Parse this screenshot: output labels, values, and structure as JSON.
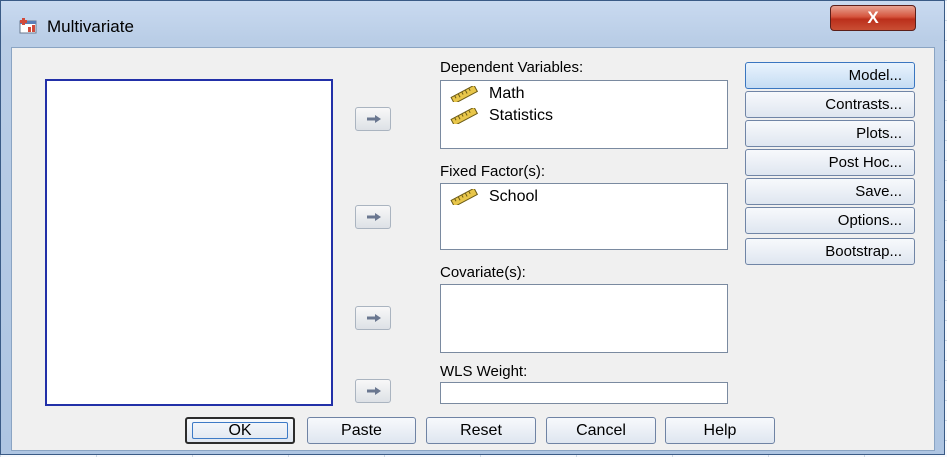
{
  "window": {
    "title": "Multivariate",
    "close_glyph": "X"
  },
  "dependent": {
    "label": "Dependent Variables:",
    "items": [
      {
        "name": "Math",
        "icon": "scale-ruler-icon"
      },
      {
        "name": "Statistics",
        "icon": "scale-ruler-icon"
      }
    ]
  },
  "fixed": {
    "label": "Fixed Factor(s):",
    "items": [
      {
        "name": "School",
        "icon": "scale-ruler-icon"
      }
    ]
  },
  "covariate": {
    "label": "Covariate(s):"
  },
  "wls": {
    "label": "WLS Weight:",
    "value": ""
  },
  "side_buttons": {
    "model": "Model...",
    "contrasts": "Contrasts...",
    "plots": "Plots...",
    "post_hoc": "Post Hoc...",
    "save": "Save...",
    "options": "Options...",
    "bootstrap": "Bootstrap..."
  },
  "bottom_buttons": {
    "ok": "OK",
    "paste": "Paste",
    "reset": "Reset",
    "cancel": "Cancel",
    "help": "Help"
  },
  "colors": {
    "titlebar": "#c9daf0",
    "close_button": "#c94e34",
    "list_border_focus": "#2230a8"
  }
}
